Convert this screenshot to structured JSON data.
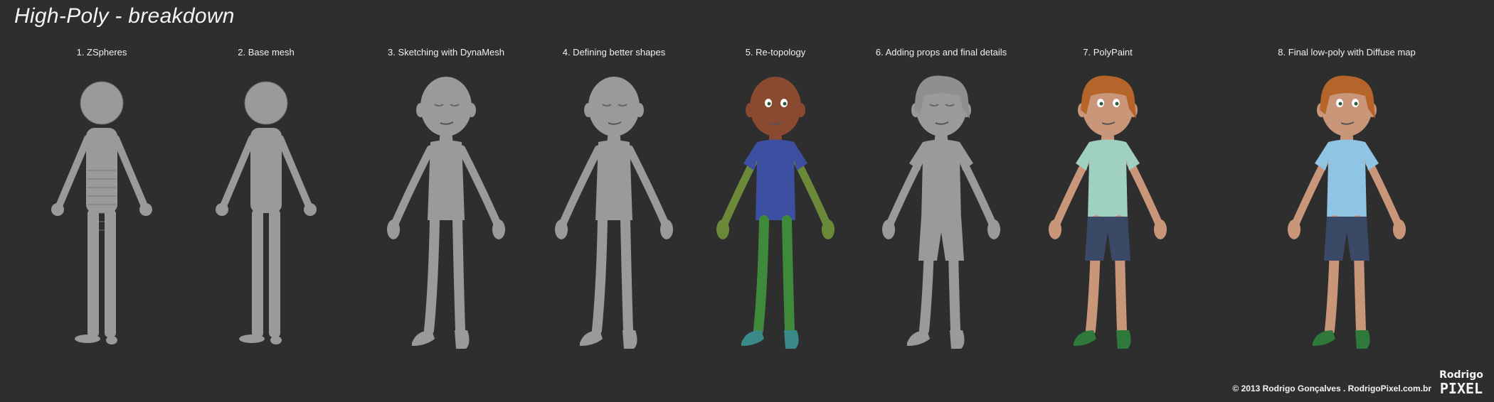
{
  "title": "High-Poly - breakdown",
  "stages": [
    {
      "label": "1. ZSpheres",
      "style": "zspheres"
    },
    {
      "label": "2. Base mesh",
      "style": "basemesh"
    },
    {
      "label": "3. Sketching with DynaMesh",
      "style": "sculpt"
    },
    {
      "label": "4. Defining better shapes",
      "style": "sculpt"
    },
    {
      "label": "5. Re-topology",
      "style": "retopo"
    },
    {
      "label": "6. Adding props and final details",
      "style": "detailed"
    },
    {
      "label": "7. PolyPaint",
      "style": "polypaint"
    },
    {
      "label": "8. Final low-poly with Diffuse map",
      "style": "final"
    }
  ],
  "footer": {
    "copyright": "© 2013 Rodrigo Gonçalves . RodrigoPixel.com.br",
    "logo_text": "Rodrigo PIXEL"
  },
  "colors": {
    "background": "#2e2e2e",
    "clay": "#9a9a9a",
    "skin": "#c9967a",
    "hair": "#b5652a",
    "shirt_polypaint": "#9fd0c0",
    "shirt_final": "#8fc5e3",
    "shorts": "#3a4a66",
    "shoes": "#2f7a3a"
  }
}
